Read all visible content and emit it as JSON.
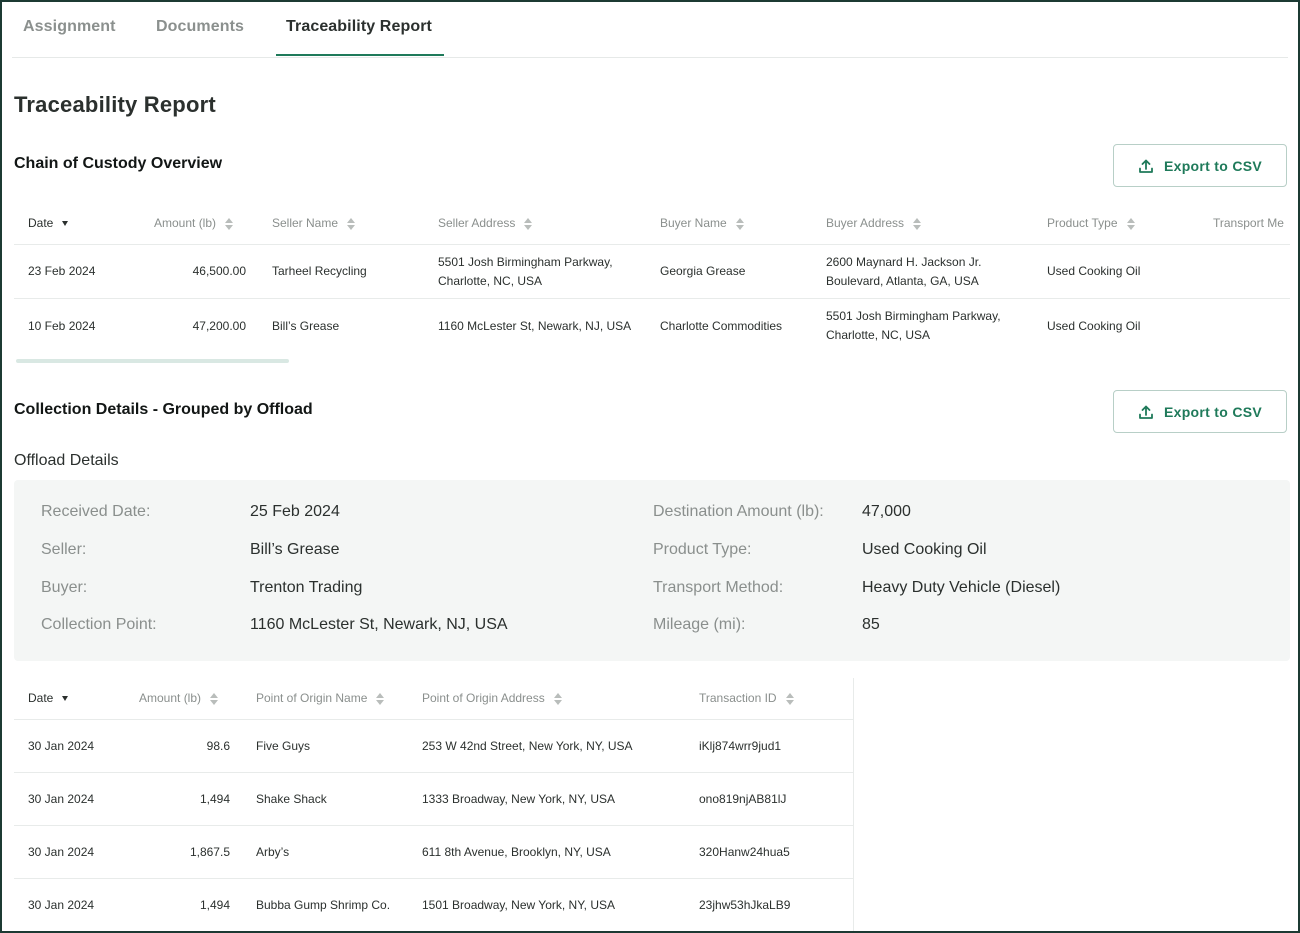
{
  "tabs": [
    {
      "label": "Assignment"
    },
    {
      "label": "Documents"
    },
    {
      "label": "Traceability Report"
    }
  ],
  "page_title": "Traceability Report",
  "chain": {
    "title": "Chain of Custody Overview",
    "export_label": "Export to CSV",
    "columns": [
      "Date",
      "Amount (lb)",
      "Seller Name",
      "Seller Address",
      "Buyer Name",
      "Buyer Address",
      "Product Type",
      "Transport Me"
    ],
    "rows": [
      {
        "date": "23 Feb 2024",
        "amount": "46,500.00",
        "seller_name": "Tarheel Recycling",
        "seller_address_1": "5501 Josh Birmingham Parkway,",
        "seller_address_2": "Charlotte, NC, USA",
        "buyer_name": "Georgia Grease",
        "buyer_address_1": "2600 Maynard H. Jackson Jr.",
        "buyer_address_2": "Boulevard, Atlanta, GA, USA",
        "product_type": "Used Cooking Oil"
      },
      {
        "date": "10 Feb 2024",
        "amount": "47,200.00",
        "seller_name": "Bill’s Grease",
        "seller_address_1": "1160 McLester St, Newark, NJ, USA",
        "seller_address_2": "",
        "buyer_name": "Charlotte Commodities",
        "buyer_address_1": "5501 Josh Birmingham Parkway,",
        "buyer_address_2": "Charlotte, NC, USA",
        "product_type": "Used Cooking Oil"
      }
    ]
  },
  "collection": {
    "title": "Collection Details - Grouped by Offload",
    "export_label": "Export to CSV",
    "offload_label": "Offload Details",
    "details_left": [
      {
        "label": "Received Date:",
        "value": "25 Feb 2024"
      },
      {
        "label": "Seller:",
        "value": "Bill’s Grease"
      },
      {
        "label": "Buyer:",
        "value": "Trenton Trading"
      },
      {
        "label": "Collection Point:",
        "value": "1160 McLester St, Newark, NJ, USA"
      }
    ],
    "details_right": [
      {
        "label": "Destination Amount (lb):",
        "value": "47,000"
      },
      {
        "label": "Product Type:",
        "value": "Used Cooking Oil"
      },
      {
        "label": "Transport Method:",
        "value": "Heavy Duty Vehicle (Diesel)"
      },
      {
        "label": "Mileage (mi):",
        "value": "85"
      }
    ],
    "columns": [
      "Date",
      "Amount (lb)",
      "Point of Origin Name",
      "Point of Origin Address",
      "Transaction ID"
    ],
    "rows": [
      {
        "date": "30 Jan 2024",
        "amount": "98.6",
        "origin_name": "Five Guys",
        "origin_address": "253 W 42nd Street, New York, NY, USA",
        "txn": "iKlj874wrr9jud1"
      },
      {
        "date": "30 Jan 2024",
        "amount": "1,494",
        "origin_name": "Shake Shack",
        "origin_address": "1333 Broadway, New York, NY, USA",
        "txn": "ono819njAB81lJ"
      },
      {
        "date": "30 Jan 2024",
        "amount": "1,867.5",
        "origin_name": "Arby’s",
        "origin_address": "611 8th Avenue, Brooklyn, NY, USA",
        "txn": "320Hanw24hua5"
      },
      {
        "date": "30 Jan 2024",
        "amount": "1,494",
        "origin_name": "Bubba Gump Shrimp Co.",
        "origin_address": "1501 Broadway, New York, NY, USA",
        "txn": "23jhw53hJkaLB9"
      }
    ]
  },
  "icons": {
    "export": "upload-icon",
    "sort": "sort-icon",
    "sort_desc": "sort-desc-icon"
  },
  "colors": {
    "accent": "#1f7a5a",
    "border": "#1c3a33",
    "details_bg": "#f4f6f5"
  }
}
